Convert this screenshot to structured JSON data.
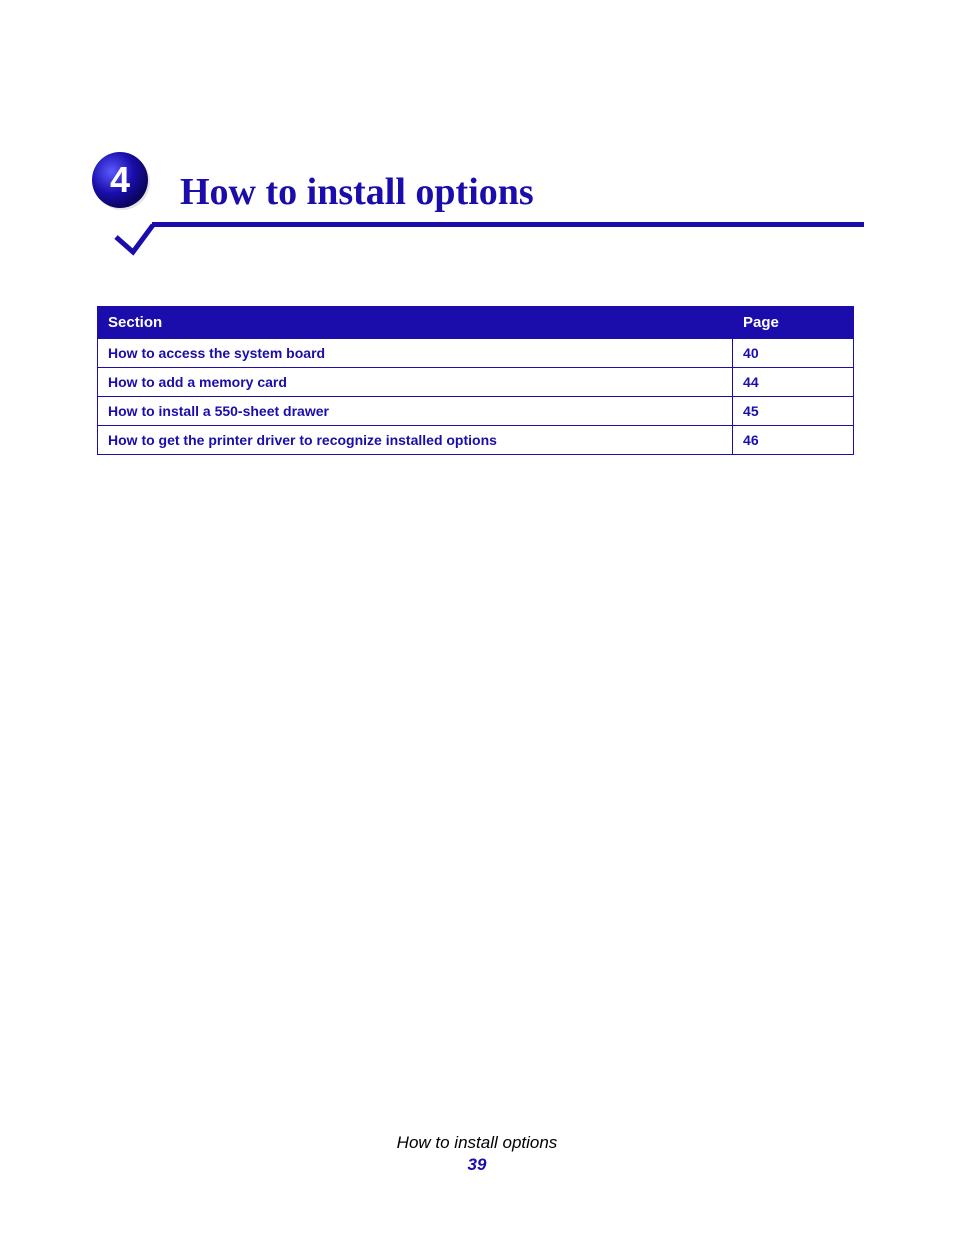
{
  "chapter": {
    "number": "4",
    "title": "How to install options"
  },
  "toc": {
    "headers": {
      "section": "Section",
      "page": "Page"
    },
    "rows": [
      {
        "section": "How to access the system board",
        "page": "40"
      },
      {
        "section": "How to add a memory card",
        "page": "44"
      },
      {
        "section": "How to install a 550-sheet drawer",
        "page": "45"
      },
      {
        "section": "How to get the printer driver to recognize installed options",
        "page": "46"
      }
    ]
  },
  "footer": {
    "title": "How to install options",
    "page_number": "39"
  },
  "colors": {
    "primary_blue": "#1a0dab"
  }
}
